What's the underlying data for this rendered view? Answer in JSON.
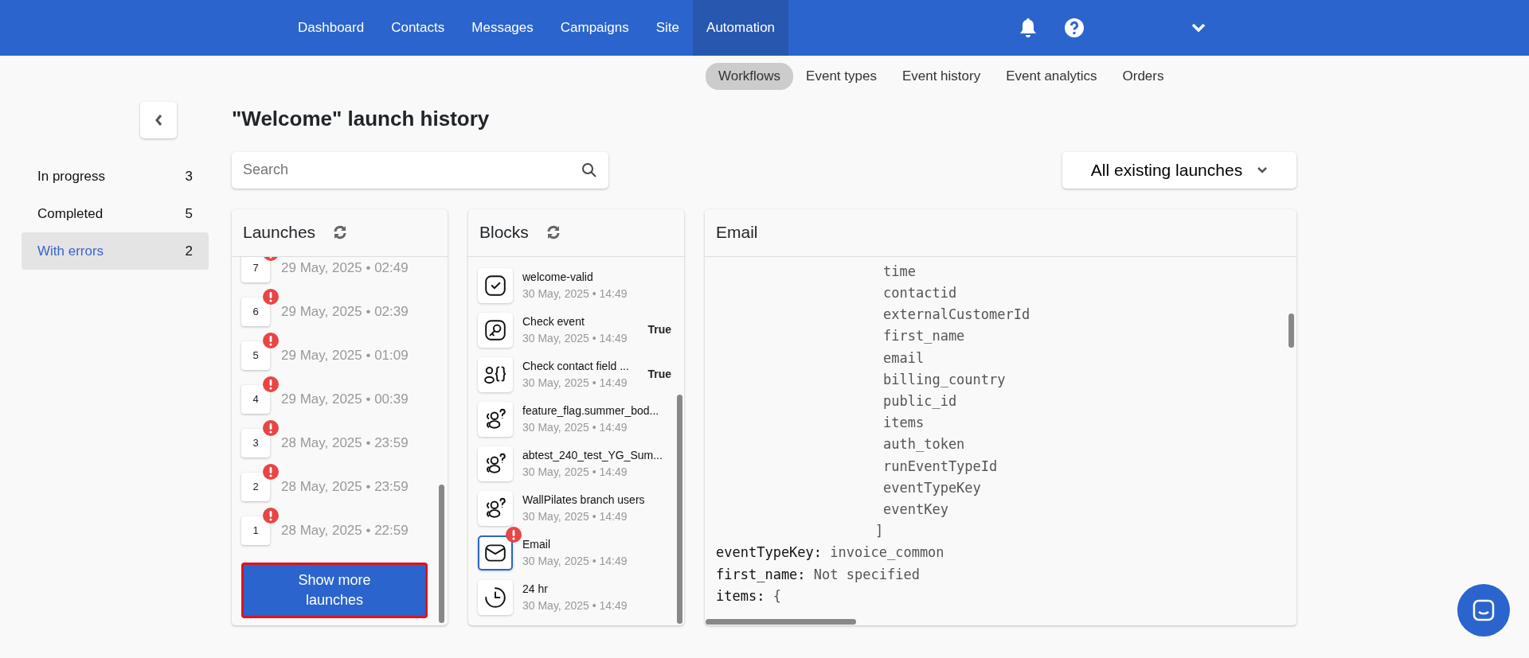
{
  "nav": [
    {
      "label": "Dashboard",
      "selected": false
    },
    {
      "label": "Contacts",
      "selected": false
    },
    {
      "label": "Messages",
      "selected": false
    },
    {
      "label": "Campaigns",
      "selected": false
    },
    {
      "label": "Site",
      "selected": false
    },
    {
      "label": "Automation",
      "selected": true
    }
  ],
  "subnav": [
    {
      "label": "Workflows",
      "selected": true
    },
    {
      "label": "Event types",
      "selected": false
    },
    {
      "label": "Event history",
      "selected": false
    },
    {
      "label": "Event analytics",
      "selected": false
    },
    {
      "label": "Orders",
      "selected": false
    }
  ],
  "title": "\"Welcome\" launch history",
  "filters": [
    {
      "label": "In progress",
      "count": "3",
      "selected": false
    },
    {
      "label": "Completed",
      "count": "5",
      "selected": false
    },
    {
      "label": "With errors",
      "count": "2",
      "selected": true
    }
  ],
  "search": {
    "placeholder": "Search"
  },
  "launch_filter": {
    "value": "All existing launches"
  },
  "launches_panel": {
    "title": "Launches",
    "items": [
      {
        "number": "7",
        "date": "29 May, 2025 • 02:49",
        "error": true
      },
      {
        "number": "6",
        "date": "29 May, 2025 • 02:39",
        "error": true
      },
      {
        "number": "5",
        "date": "29 May, 2025 • 01:09",
        "error": true
      },
      {
        "number": "4",
        "date": "29 May, 2025 • 00:39",
        "error": true
      },
      {
        "number": "3",
        "date": "28 May, 2025 • 23:59",
        "error": true
      },
      {
        "number": "2",
        "date": "28 May, 2025 • 23:59",
        "error": true
      },
      {
        "number": "1",
        "date": "28 May, 2025 • 22:59",
        "error": true
      }
    ],
    "more_button": "Show more launches"
  },
  "blocks_panel": {
    "title": "Blocks",
    "items": [
      {
        "kind": "check",
        "name": "welcome-valid",
        "date": "30 May, 2025 • 14:49",
        "error": false,
        "selected": false
      },
      {
        "kind": "key",
        "name": "Check event",
        "date": "30 May, 2025 • 14:49",
        "result": "True",
        "error": false,
        "selected": false
      },
      {
        "kind": "fields",
        "name": "Check contact field ...",
        "date": "30 May, 2025 • 14:49",
        "result": "True",
        "error": false,
        "selected": false
      },
      {
        "kind": "segment",
        "name": "feature_flag.summer_bod...",
        "date": "30 May, 2025 • 14:49",
        "error": false,
        "selected": false
      },
      {
        "kind": "segment",
        "name": "abtest_240_test_YG_Sum...",
        "date": "30 May, 2025 • 14:49",
        "error": false,
        "selected": false
      },
      {
        "kind": "segment",
        "name": "WallPilates branch users",
        "date": "30 May, 2025 • 14:49",
        "error": false,
        "selected": false
      },
      {
        "kind": "email",
        "name": "Email",
        "date": "30 May, 2025 • 14:49",
        "error": true,
        "selected": true
      },
      {
        "kind": "timer",
        "name": "24 hr",
        "date": "30 May, 2025 • 14:49",
        "error": false,
        "selected": false
      }
    ]
  },
  "detail_panel": {
    "title": "Email",
    "array_items": [
      "time",
      "contactid",
      "externalCustomerId",
      "first_name",
      "email",
      "billing_country",
      "public_id",
      "items",
      "auth_token",
      "runEventTypeId",
      "eventTypeKey",
      "eventKey"
    ],
    "array_close": "]",
    "fields": [
      {
        "key": "eventTypeKey:",
        "value": "invoice_common"
      },
      {
        "key": "first_name:",
        "value": "Not specified"
      },
      {
        "key": "items:",
        "value": "{"
      }
    ]
  }
}
